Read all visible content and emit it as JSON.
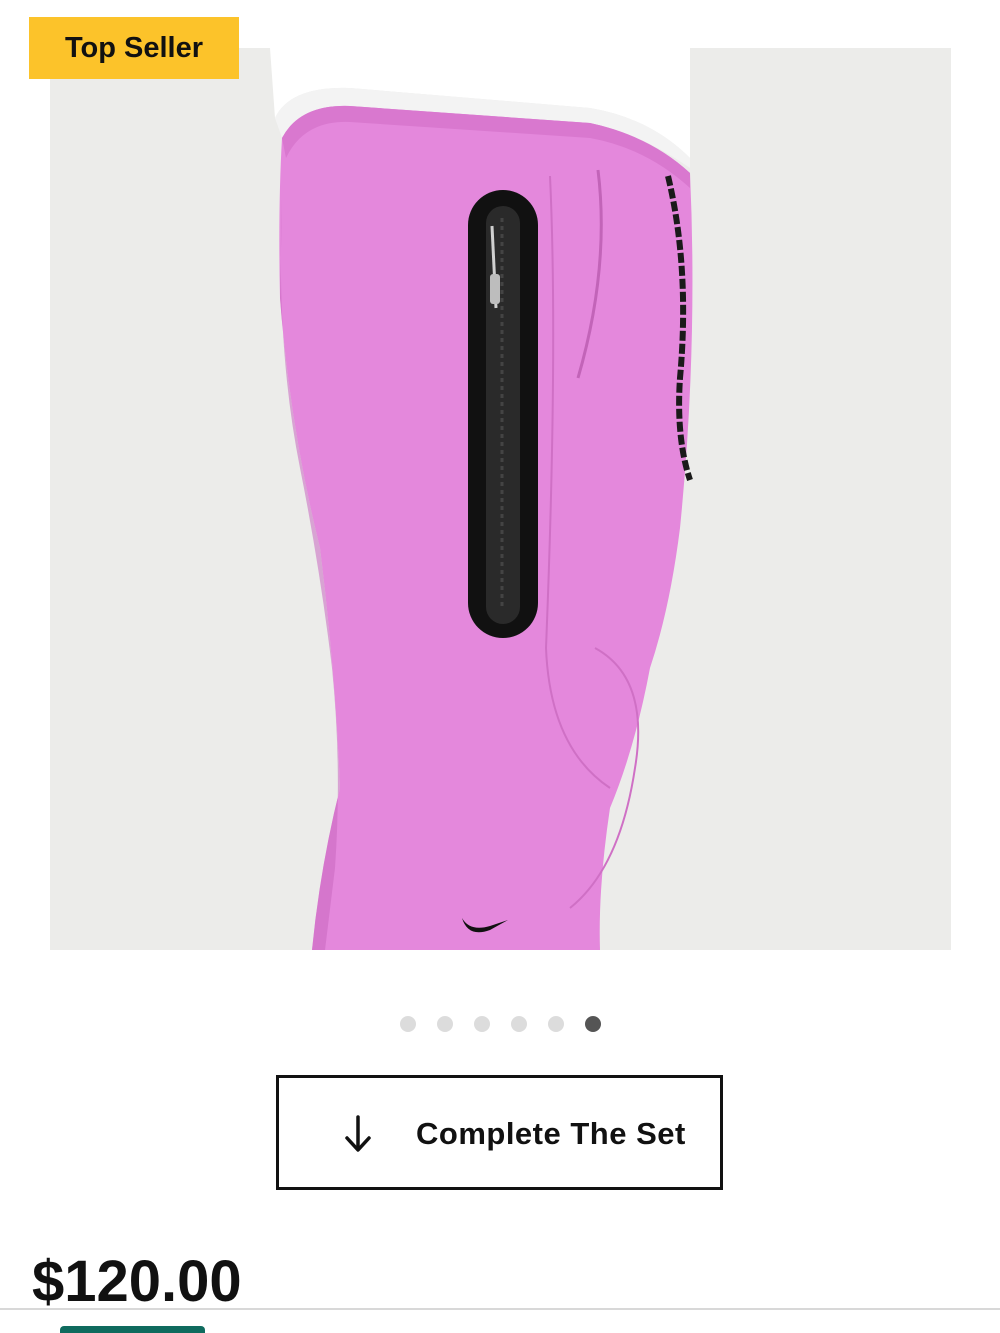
{
  "badge": {
    "label": "Top Seller",
    "color": "#fcc32a"
  },
  "product": {
    "image_alt": "Pink tech fleece jogger pants",
    "pants_color": "#e488dc",
    "zip_color": "#111111"
  },
  "carousel": {
    "total": 6,
    "active_index": 5
  },
  "complete_set": {
    "label": "Complete The Set",
    "icon": "arrow-down-icon"
  },
  "price": {
    "value": "$120.00"
  }
}
